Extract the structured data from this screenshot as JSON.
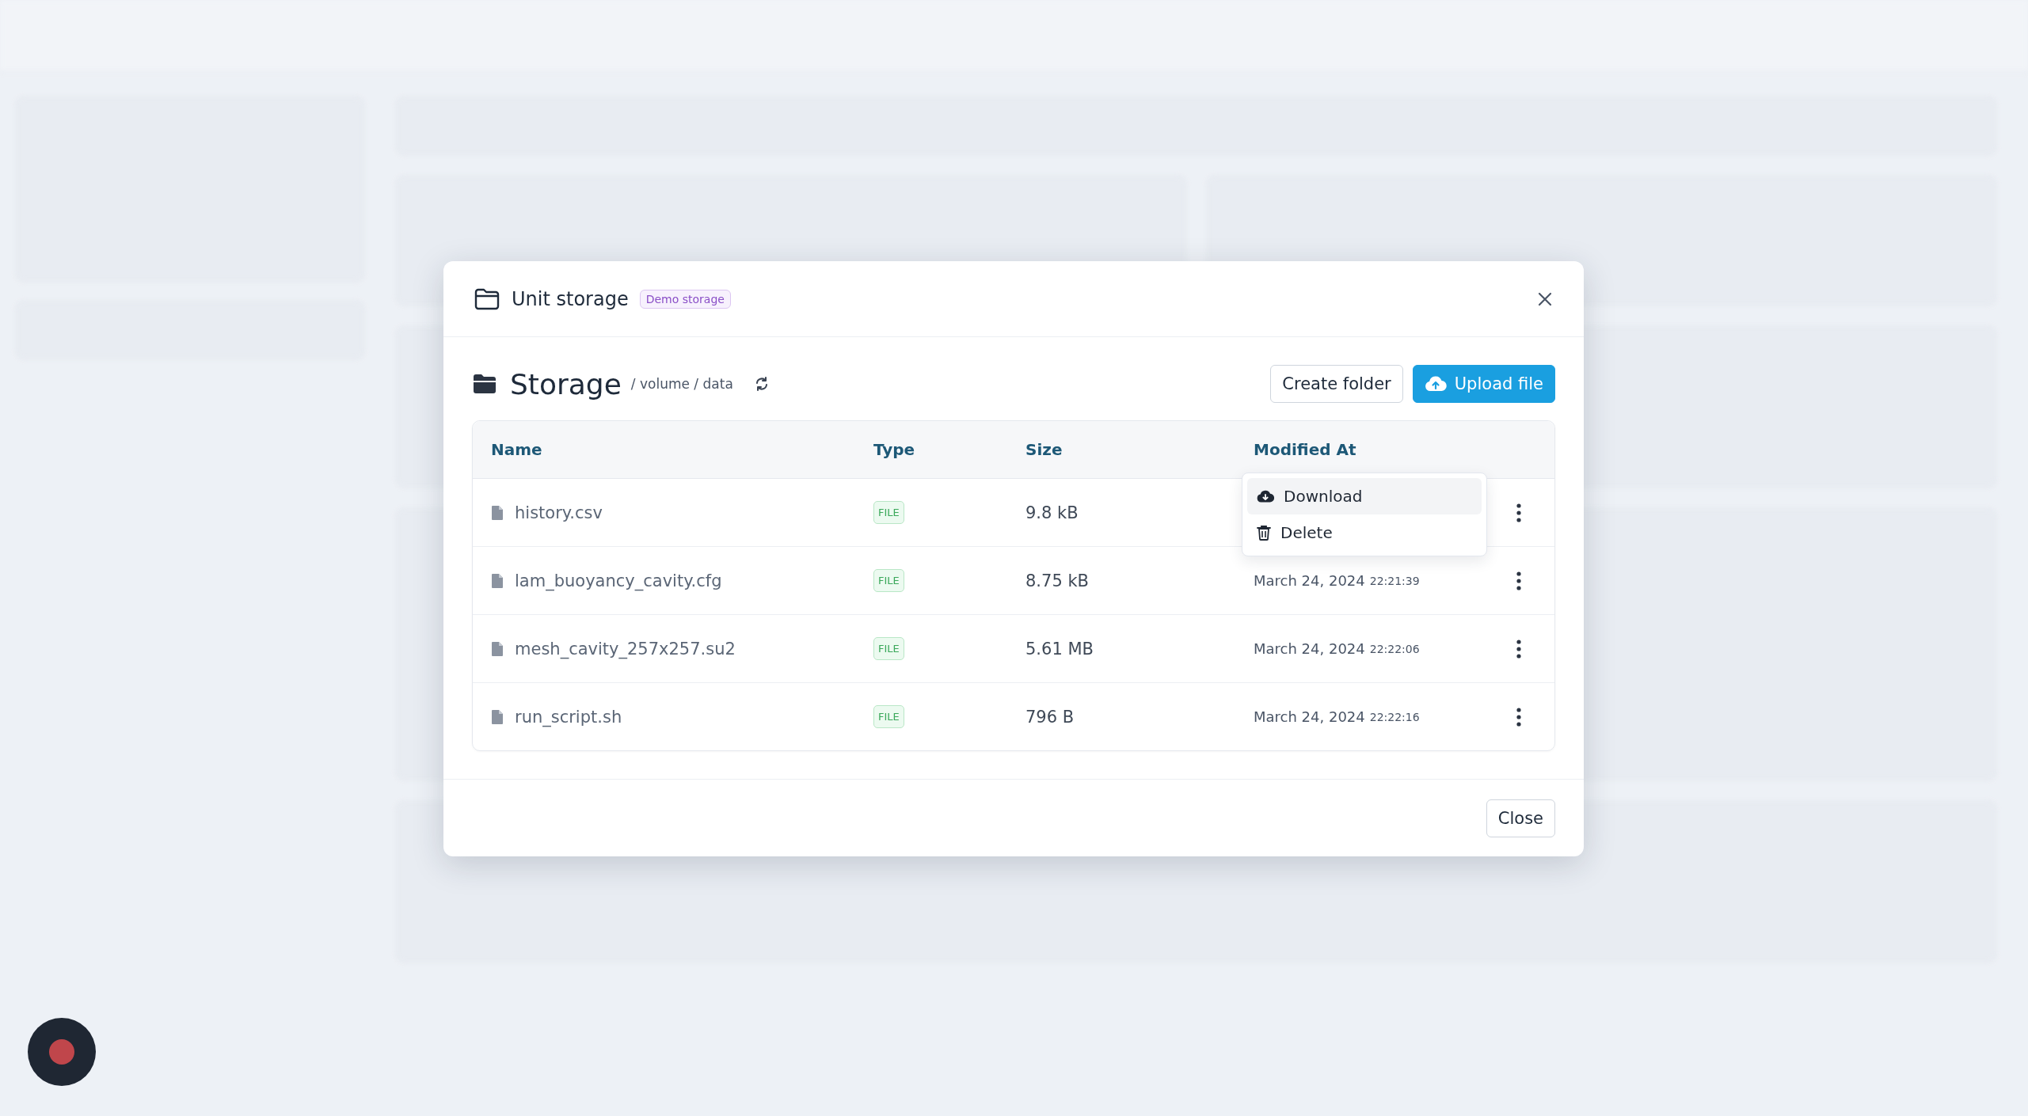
{
  "dialog": {
    "title": "Unit storage",
    "badge": "Demo storage",
    "close_label": "Close"
  },
  "storage": {
    "title": "Storage",
    "path": "/ volume / data"
  },
  "actions": [
    {
      "label": "Create folder",
      "kind": "secondary"
    },
    {
      "label": "Upload file",
      "kind": "primary"
    }
  ],
  "table": {
    "columns": [
      "Name",
      "Type",
      "Size",
      "Modified At"
    ],
    "rows": [
      {
        "name": "history.csv",
        "type": "FILE",
        "size": "9.8 kB",
        "menu": [
          {
            "label": "Download",
            "kind": "download",
            "highlighted": true
          },
          {
            "label": "Delete",
            "kind": "delete",
            "highlighted": false
          }
        ]
      },
      {
        "name": "lam_buoyancy_cavity.cfg",
        "type": "FILE",
        "size": "8.75 kB",
        "modified_date": "March 24, 2024",
        "modified_time": "22:21:39"
      },
      {
        "name": "mesh_cavity_257x257.su2",
        "type": "FILE",
        "size": "5.61 MB",
        "modified_date": "March 24, 2024",
        "modified_time": "22:22:06"
      },
      {
        "name": "run_script.sh",
        "type": "FILE",
        "size": "796 B",
        "modified_date": "March 24, 2024",
        "modified_time": "22:22:16"
      }
    ]
  }
}
